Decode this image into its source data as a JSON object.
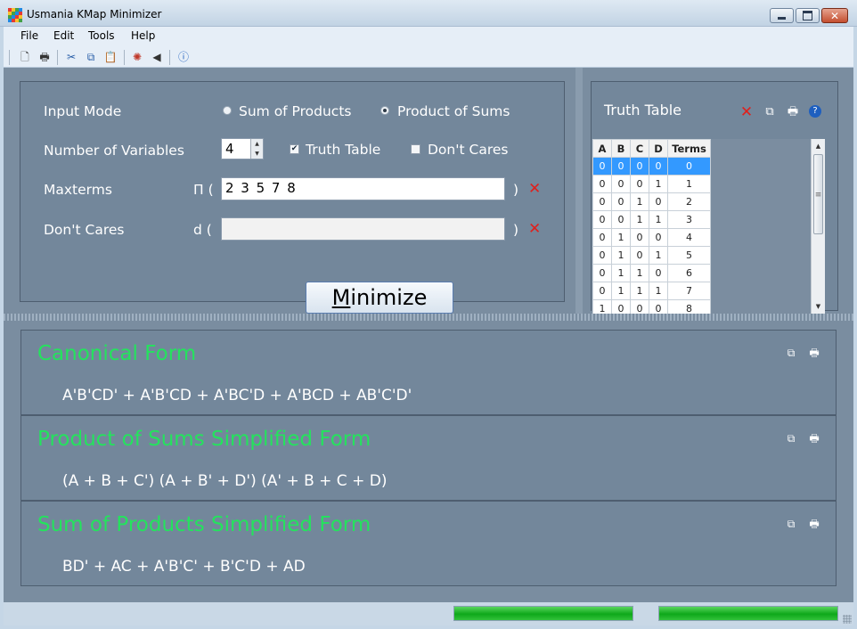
{
  "window": {
    "title": "Usmania KMap Minimizer"
  },
  "menu": [
    "File",
    "Edit",
    "Tools",
    "Help"
  ],
  "toolbar_icons": [
    "new-icon",
    "print-icon",
    "cut-icon",
    "copy-icon",
    "paste-icon",
    "settings-icon",
    "speaker-icon",
    "help-icon"
  ],
  "input": {
    "mode_label": "Input Mode",
    "mode_sop": "Sum of Products",
    "mode_pos": "Product of Sums",
    "mode_selected": "Product of Sums",
    "variables_label": "Number of Variables",
    "variables_value": "4",
    "truth_table_label": "Truth Table",
    "truth_table_checked": true,
    "dont_cares_label": "Don't Cares",
    "dont_cares_checked": false,
    "maxterms_label": "Maxterms",
    "maxterms_prefix": "Π (",
    "maxterms_value": "2 3 5 7 8",
    "maxterms_suffix": ")",
    "dontcare_label": "Don't Cares",
    "dontcare_prefix": "d (",
    "dontcare_value": "",
    "dontcare_suffix": ")",
    "minimize_first": "M",
    "minimize_rest": "inimize"
  },
  "truth_table": {
    "title": "Truth Table",
    "headers": [
      "A",
      "B",
      "C",
      "D",
      "Terms"
    ],
    "rows": [
      [
        "0",
        "0",
        "0",
        "0",
        "0"
      ],
      [
        "0",
        "0",
        "0",
        "1",
        "1"
      ],
      [
        "0",
        "0",
        "1",
        "0",
        "2"
      ],
      [
        "0",
        "0",
        "1",
        "1",
        "3"
      ],
      [
        "0",
        "1",
        "0",
        "0",
        "4"
      ],
      [
        "0",
        "1",
        "0",
        "1",
        "5"
      ],
      [
        "0",
        "1",
        "1",
        "0",
        "6"
      ],
      [
        "0",
        "1",
        "1",
        "1",
        "7"
      ],
      [
        "1",
        "0",
        "0",
        "0",
        "8"
      ]
    ],
    "selected_row": 0
  },
  "results": {
    "canonical_title": "Canonical Form",
    "canonical_expr": "A'B'CD' + A'B'CD + A'BC'D + A'BCD + AB'C'D'",
    "pos_title": "Product of Sums Simplified Form",
    "pos_expr": "(A + B + C') (A + B' + D') (A' + B + C + D)",
    "sop_title": "Sum of Products Simplified Form",
    "sop_expr": "BD' + AC + A'B'C' + B'C'D + AD"
  },
  "status": {
    "progress1": 1.0,
    "progress2": 1.0
  },
  "colors": {
    "panel": "#73879b",
    "result_title": "#24e35d",
    "accent_close": "#e0201c",
    "selection": "#3399ff"
  }
}
